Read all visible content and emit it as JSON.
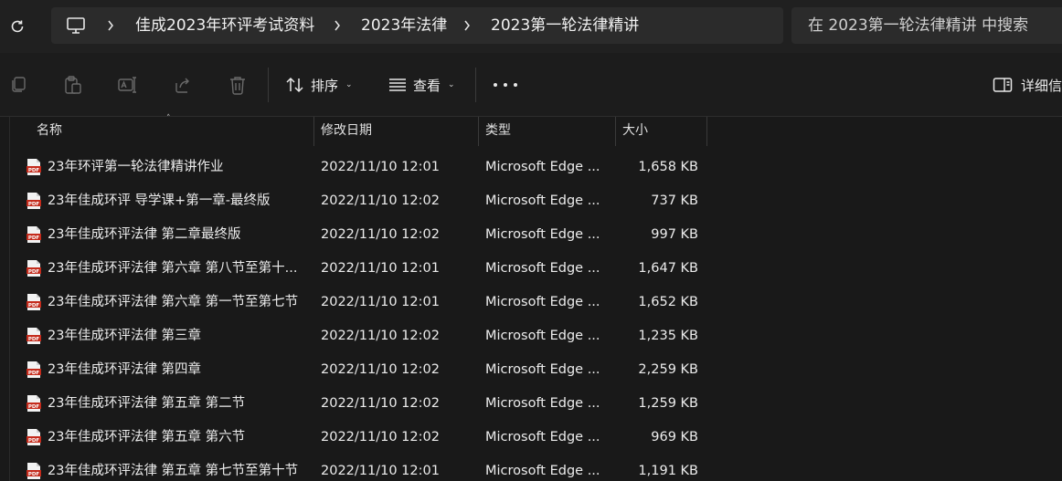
{
  "address_bar": {
    "breadcrumbs": [
      "佳成2023年环评考试资料",
      "2023年法律",
      "2023第一轮法律精讲"
    ],
    "search_placeholder": "在 2023第一轮法律精讲 中搜索"
  },
  "toolbar": {
    "sort_label": "排序",
    "view_label": "查看",
    "details_label": "详细信息"
  },
  "columns": {
    "name": "名称",
    "date": "修改日期",
    "type": "类型",
    "size": "大小"
  },
  "files": [
    {
      "name": "23年环评第一轮法律精讲作业",
      "date": "2022/11/10 12:01",
      "type": "Microsoft Edge ...",
      "size": "1,658 KB"
    },
    {
      "name": "23年佳成环评 导学课+第一章-最终版",
      "date": "2022/11/10 12:02",
      "type": "Microsoft Edge ...",
      "size": "737 KB"
    },
    {
      "name": "23年佳成环评法律 第二章最终版",
      "date": "2022/11/10 12:02",
      "type": "Microsoft Edge ...",
      "size": "997 KB"
    },
    {
      "name": "23年佳成环评法律 第六章 第八节至第十...",
      "date": "2022/11/10 12:01",
      "type": "Microsoft Edge ...",
      "size": "1,647 KB"
    },
    {
      "name": "23年佳成环评法律 第六章 第一节至第七节",
      "date": "2022/11/10 12:01",
      "type": "Microsoft Edge ...",
      "size": "1,652 KB"
    },
    {
      "name": "23年佳成环评法律 第三章",
      "date": "2022/11/10 12:02",
      "type": "Microsoft Edge ...",
      "size": "1,235 KB"
    },
    {
      "name": "23年佳成环评法律 第四章",
      "date": "2022/11/10 12:02",
      "type": "Microsoft Edge ...",
      "size": "2,259 KB"
    },
    {
      "name": "23年佳成环评法律 第五章 第二节",
      "date": "2022/11/10 12:02",
      "type": "Microsoft Edge ...",
      "size": "1,259 KB"
    },
    {
      "name": "23年佳成环评法律 第五章 第六节",
      "date": "2022/11/10 12:02",
      "type": "Microsoft Edge ...",
      "size": "969 KB"
    },
    {
      "name": "23年佳成环评法律 第五章 第七节至第十节",
      "date": "2022/11/10 12:01",
      "type": "Microsoft Edge ...",
      "size": "1,191 KB"
    }
  ],
  "icons": {
    "refresh": "refresh-icon",
    "pc": "this-pc-icon",
    "copy": "copy-icon",
    "paste": "paste-icon",
    "rename": "rename-icon",
    "share": "share-icon",
    "delete": "delete-icon",
    "sort": "sort-icon",
    "view": "view-icon",
    "more": "more-icon",
    "details": "details-pane-icon",
    "pdf": "pdf-file-icon"
  },
  "colors": {
    "background": "#191919",
    "address_box": "#2b2b2b",
    "pdf_red": "#c42b1c"
  }
}
